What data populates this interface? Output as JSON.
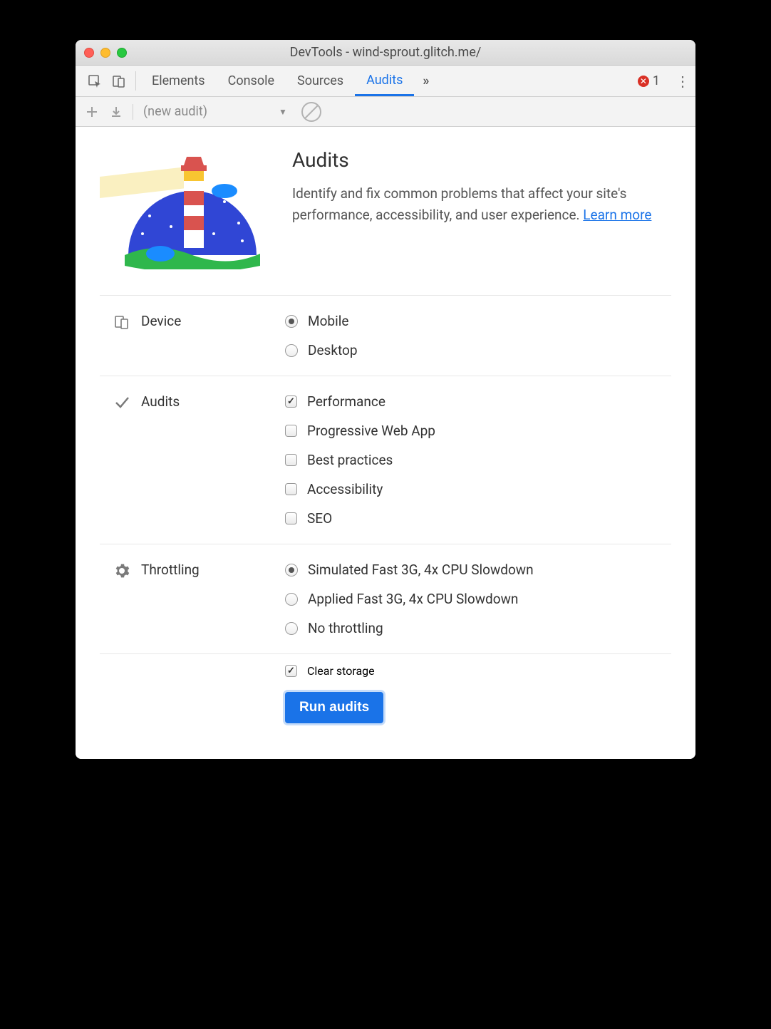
{
  "window": {
    "title": "DevTools - wind-sprout.glitch.me/"
  },
  "tabs": {
    "items": [
      {
        "label": "Elements",
        "active": false
      },
      {
        "label": "Console",
        "active": false
      },
      {
        "label": "Sources",
        "active": false
      },
      {
        "label": "Audits",
        "active": true
      }
    ],
    "overflow_glyph": "»",
    "error_count": "1"
  },
  "toolbar": {
    "dropdown_label": "(new audit)"
  },
  "header": {
    "title": "Audits",
    "description_pre": "Identify and fix common problems that affect your site's performance, accessibility, and user experience. ",
    "learn_more": "Learn more"
  },
  "sections": {
    "device": {
      "label": "Device",
      "options": [
        {
          "label": "Mobile",
          "checked": true
        },
        {
          "label": "Desktop",
          "checked": false
        }
      ]
    },
    "audits": {
      "label": "Audits",
      "options": [
        {
          "label": "Performance",
          "checked": true
        },
        {
          "label": "Progressive Web App",
          "checked": false
        },
        {
          "label": "Best practices",
          "checked": false
        },
        {
          "label": "Accessibility",
          "checked": false
        },
        {
          "label": "SEO",
          "checked": false
        }
      ]
    },
    "throttling": {
      "label": "Throttling",
      "options": [
        {
          "label": "Simulated Fast 3G, 4x CPU Slowdown",
          "checked": true
        },
        {
          "label": "Applied Fast 3G, 4x CPU Slowdown",
          "checked": false
        },
        {
          "label": "No throttling",
          "checked": false
        }
      ]
    },
    "clear_storage": {
      "label": "Clear storage",
      "checked": true
    }
  },
  "run_button": "Run audits"
}
